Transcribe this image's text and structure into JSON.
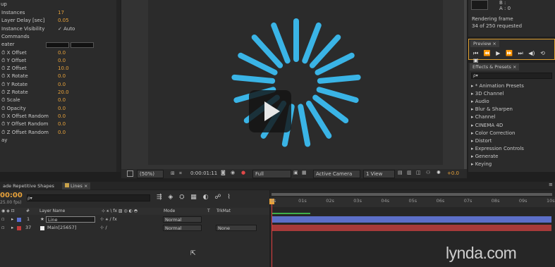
{
  "effect_controls": {
    "header_fragment": "up",
    "rows": [
      {
        "label": "Instances",
        "value": "17"
      },
      {
        "label": "Layer Delay [sec]",
        "value": "0.05"
      },
      {
        "label": "Instance Visibility",
        "value": "✓ Auto"
      },
      {
        "label": "Commands",
        "value": ""
      },
      {
        "label": "eater",
        "value": ""
      },
      {
        "label": "⏱ X Offset",
        "value": "0.0"
      },
      {
        "label": "⏱ Y Offset",
        "value": "0.0"
      },
      {
        "label": "⏱ Z Offset",
        "value": "10.0"
      },
      {
        "label": "⏱ X Rotate",
        "value": "0.0"
      },
      {
        "label": "⏱ Y Rotate",
        "value": "0.0"
      },
      {
        "label": "⏱ Z Rotate",
        "value": "20.0"
      },
      {
        "label": "⏱ Scale",
        "value": "0.0"
      },
      {
        "label": "⏱ Opacity",
        "value": "0.0"
      },
      {
        "label": "⏱ X Offset Random",
        "value": "0.0"
      },
      {
        "label": "⏱ Y Offset Random",
        "value": "0.0"
      },
      {
        "label": "⏱ Z Offset Random",
        "value": "0.0"
      },
      {
        "label": "ay",
        "value": ""
      }
    ]
  },
  "info": {
    "color_b": "B :",
    "color_a": "A : 0",
    "status_line1": "Rendering frame",
    "status_line2": "34 of 250 requested"
  },
  "preview": {
    "title": "Preview"
  },
  "effects_presets": {
    "title": "Effects & Presets",
    "search_placeholder": "ρ▾",
    "items": [
      "▸ * Animation Presets",
      "▸ 3D Channel",
      "▸ Audio",
      "▸ Blur & Sharpen",
      "▸ Channel",
      "▸ CINEMA 4D",
      "▸ Color Correction",
      "▸ Distort",
      "▸ Expression Controls",
      "▸ Generate",
      "▸ Keying"
    ]
  },
  "viewer": {
    "zoom": "(50%)",
    "timecode": "0:00:01:11",
    "resolution": "Full",
    "camera": "Active Camera",
    "views": "1 View",
    "exposure": "+0.0",
    "spinner_color": "#3ab4e6",
    "spinner_bars": 17
  },
  "timeline": {
    "tabs": [
      "ade Repetitive Shapes",
      "Lines"
    ],
    "timecode": "00:00",
    "fps": "25.00 fps)",
    "columns": {
      "num": "#",
      "layer_name": "Layer Name",
      "mode": "Mode",
      "t": "T",
      "trkmat": "TrkMat"
    },
    "layers": [
      {
        "num": "1",
        "name": "Line",
        "mode": "Normal",
        "trkmat": "",
        "color": "#5a6fd0"
      },
      {
        "num": "37",
        "name": "Main[25657]",
        "mode": "Normal",
        "trkmat": "None",
        "color": "#c03a3a"
      }
    ],
    "ruler_labels": [
      "0s",
      "01s",
      "02s",
      "03s",
      "04s",
      "05s",
      "06s",
      "07s",
      "08s",
      "09s",
      "10s"
    ]
  },
  "watermark": "lynda.com"
}
